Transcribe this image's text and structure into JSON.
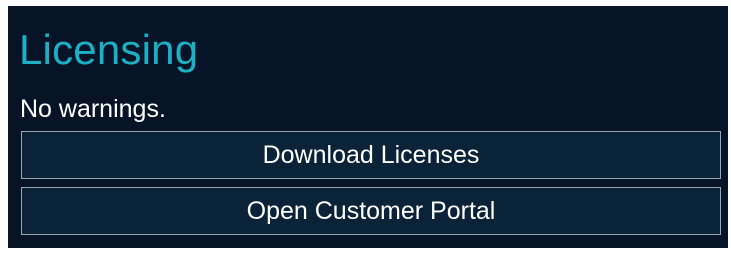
{
  "section": {
    "title": "Licensing",
    "status_text": "No warnings."
  },
  "buttons": {
    "download_label": "Download Licenses",
    "portal_label": "Open Customer Portal"
  },
  "colors": {
    "panel_background": "#071427",
    "title_accent": "#1cb0c4",
    "button_background": "#0a2338",
    "button_border": "#9aa6b3",
    "text": "#ffffff"
  }
}
